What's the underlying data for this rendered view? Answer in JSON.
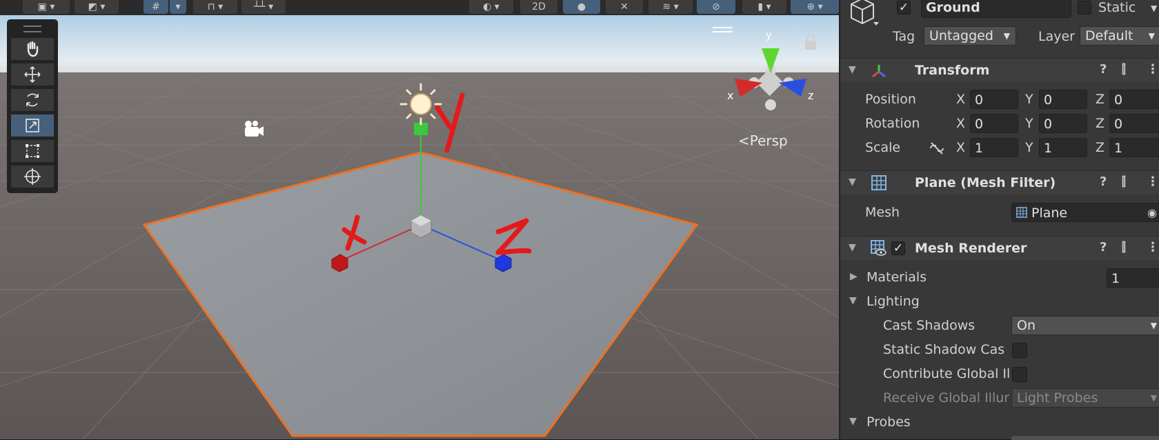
{
  "scene_view": {
    "toolbar": {
      "view_2d_label": "2D"
    },
    "camera_mode_label": "Persp",
    "axis_gizmo": {
      "x_label": "x",
      "y_label": "y",
      "z_label": "z"
    },
    "annotations": {
      "x": "X",
      "y": "Y",
      "z": "Z"
    },
    "tools": [
      "hand",
      "move",
      "rotate",
      "scale",
      "rect",
      "transform"
    ],
    "active_tool": "scale"
  },
  "inspector": {
    "object": {
      "name": "Ground",
      "active": true,
      "static_label": "Static",
      "tag_label": "Tag",
      "tag_value": "Untagged",
      "layer_label": "Layer",
      "layer_value": "Default"
    },
    "transform": {
      "title": "Transform",
      "position_label": "Position",
      "rotation_label": "Rotation",
      "scale_label": "Scale",
      "axis_x": "X",
      "axis_y": "Y",
      "axis_z": "Z",
      "position": [
        "0",
        "0",
        "0"
      ],
      "rotation": [
        "0",
        "0",
        "0"
      ],
      "scale": [
        "1",
        "1",
        "1"
      ]
    },
    "mesh_filter": {
      "title": "Plane (Mesh Filter)",
      "mesh_label": "Mesh",
      "mesh_value": "Plane"
    },
    "mesh_renderer": {
      "title": "Mesh Renderer",
      "enabled": true,
      "materials_label": "Materials",
      "materials_count": "1",
      "lighting_label": "Lighting",
      "cast_shadows_label": "Cast Shadows",
      "cast_shadows_value": "On",
      "static_shadow_label": "Static Shadow Cas",
      "contribute_gi_label": "Contribute Global Il",
      "receive_gi_label": "Receive Global Illur",
      "receive_gi_value": "Light Probes",
      "probes_label": "Probes"
    }
  },
  "colors": {
    "selection_outline": "#f07020",
    "x_axis": "#d42a2a",
    "y_axis": "#3cc83c",
    "z_axis": "#2a4fe0",
    "annotation": "#e41a1a",
    "active_tool": "#46607c"
  }
}
